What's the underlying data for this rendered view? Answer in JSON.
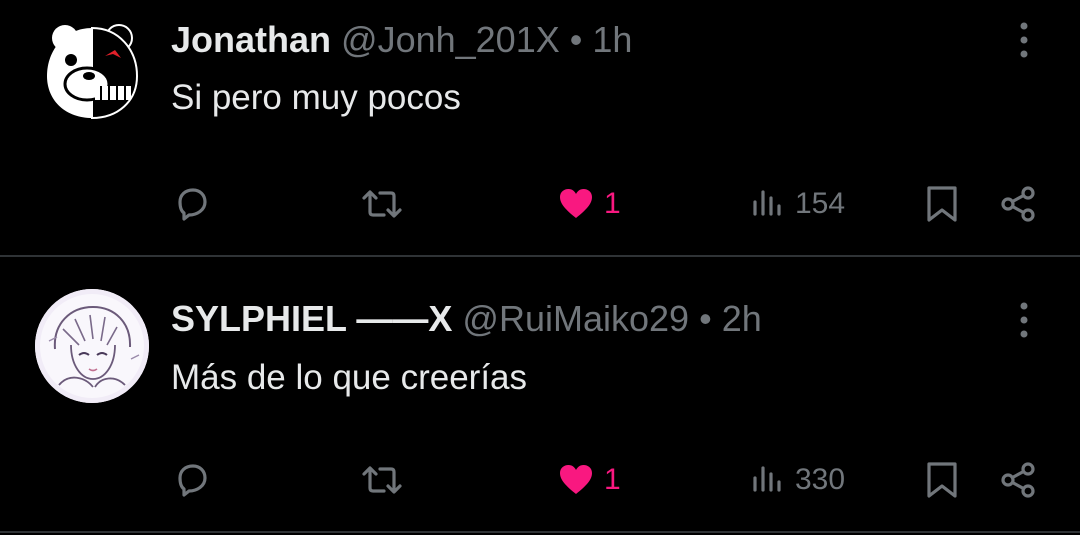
{
  "tweets": [
    {
      "display_name": "Jonathan",
      "handle": "@Jonh_201X",
      "separator": "•",
      "time": "1h",
      "text": "Si pero muy pocos",
      "likes": "1",
      "views": "154",
      "avatar_icon": "monokuma-bear-icon"
    },
    {
      "display_name": "SYLPHIEL ——X",
      "handle": "@RuiMaiko29",
      "separator": "•",
      "time": "2h",
      "text": "Más de lo que creerías",
      "likes": "1",
      "views": "330",
      "avatar_icon": "anime-sketch-avatar-icon"
    }
  ],
  "icons": [
    "reply-icon",
    "retweet-icon",
    "heart-icon",
    "views-icon",
    "bookmark-icon",
    "share-icon",
    "more-options-icon"
  ],
  "colors": {
    "background": "#000000",
    "text": "#e7e9ea",
    "muted": "#71767b",
    "like": "#f91880",
    "divider": "#2f3336"
  }
}
